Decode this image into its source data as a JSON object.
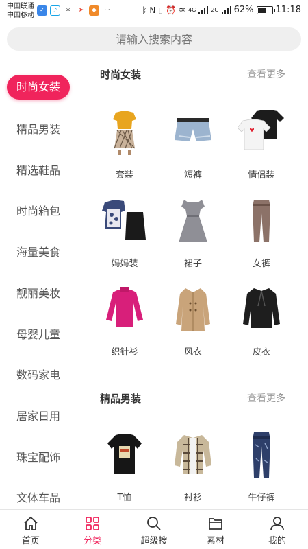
{
  "status": {
    "carrier1": "中国联通",
    "carrier2": "中国移动",
    "battery_text": "62%",
    "time": "11:18",
    "network1": "4G",
    "network2": "2G",
    "battery_level": 0.62
  },
  "search": {
    "placeholder": "请输入搜索内容"
  },
  "sidebar": {
    "items": [
      {
        "label": "时尚女装"
      },
      {
        "label": "精品男装"
      },
      {
        "label": "精选鞋品"
      },
      {
        "label": "时尚箱包"
      },
      {
        "label": "海量美食"
      },
      {
        "label": "靓丽美妆"
      },
      {
        "label": "母婴儿童"
      },
      {
        "label": "数码家电"
      },
      {
        "label": "居家日用"
      },
      {
        "label": "珠宝配饰"
      },
      {
        "label": "文体车品"
      }
    ]
  },
  "sections": [
    {
      "title": "时尚女装",
      "more": "查看更多",
      "products": [
        {
          "label": "套装"
        },
        {
          "label": "短裤"
        },
        {
          "label": "情侣装"
        },
        {
          "label": "妈妈装"
        },
        {
          "label": "裙子"
        },
        {
          "label": "女裤"
        },
        {
          "label": "织针衫"
        },
        {
          "label": "风衣"
        },
        {
          "label": "皮衣"
        }
      ]
    },
    {
      "title": "精品男装",
      "more": "查看更多",
      "products": [
        {
          "label": "T恤"
        },
        {
          "label": "衬衫"
        },
        {
          "label": "牛仔裤"
        }
      ]
    }
  ],
  "nav": {
    "items": [
      {
        "label": "首页"
      },
      {
        "label": "分类"
      },
      {
        "label": "超级搜"
      },
      {
        "label": "素材"
      },
      {
        "label": "我的"
      }
    ]
  },
  "colors": {
    "accent": "#f0245c"
  }
}
